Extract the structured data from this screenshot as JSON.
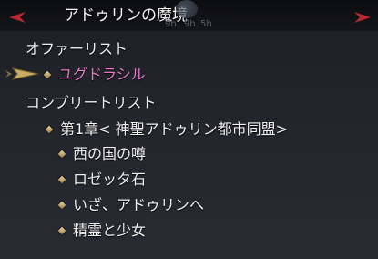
{
  "window": {
    "title": "アドゥリンの魔境",
    "ghost_labels": [
      "9h",
      "9h",
      "5h"
    ]
  },
  "offer_list": {
    "header": "オファーリスト",
    "items": [
      {
        "label": "ユグドラシル",
        "selected": true
      }
    ]
  },
  "complete_list": {
    "header": "コンプリートリスト",
    "chapter": "第1章< 神聖アドゥリン都市同盟>",
    "items": [
      {
        "label": "西の国の噂"
      },
      {
        "label": "ロゼッタ石"
      },
      {
        "label": "いざ、アドゥリンへ"
      },
      {
        "label": "精霊と少女"
      }
    ]
  },
  "colors": {
    "accent_selected": "#e47ac4",
    "nav_arrow": "#b8282f",
    "bullet_gold": "#c9ad66"
  }
}
